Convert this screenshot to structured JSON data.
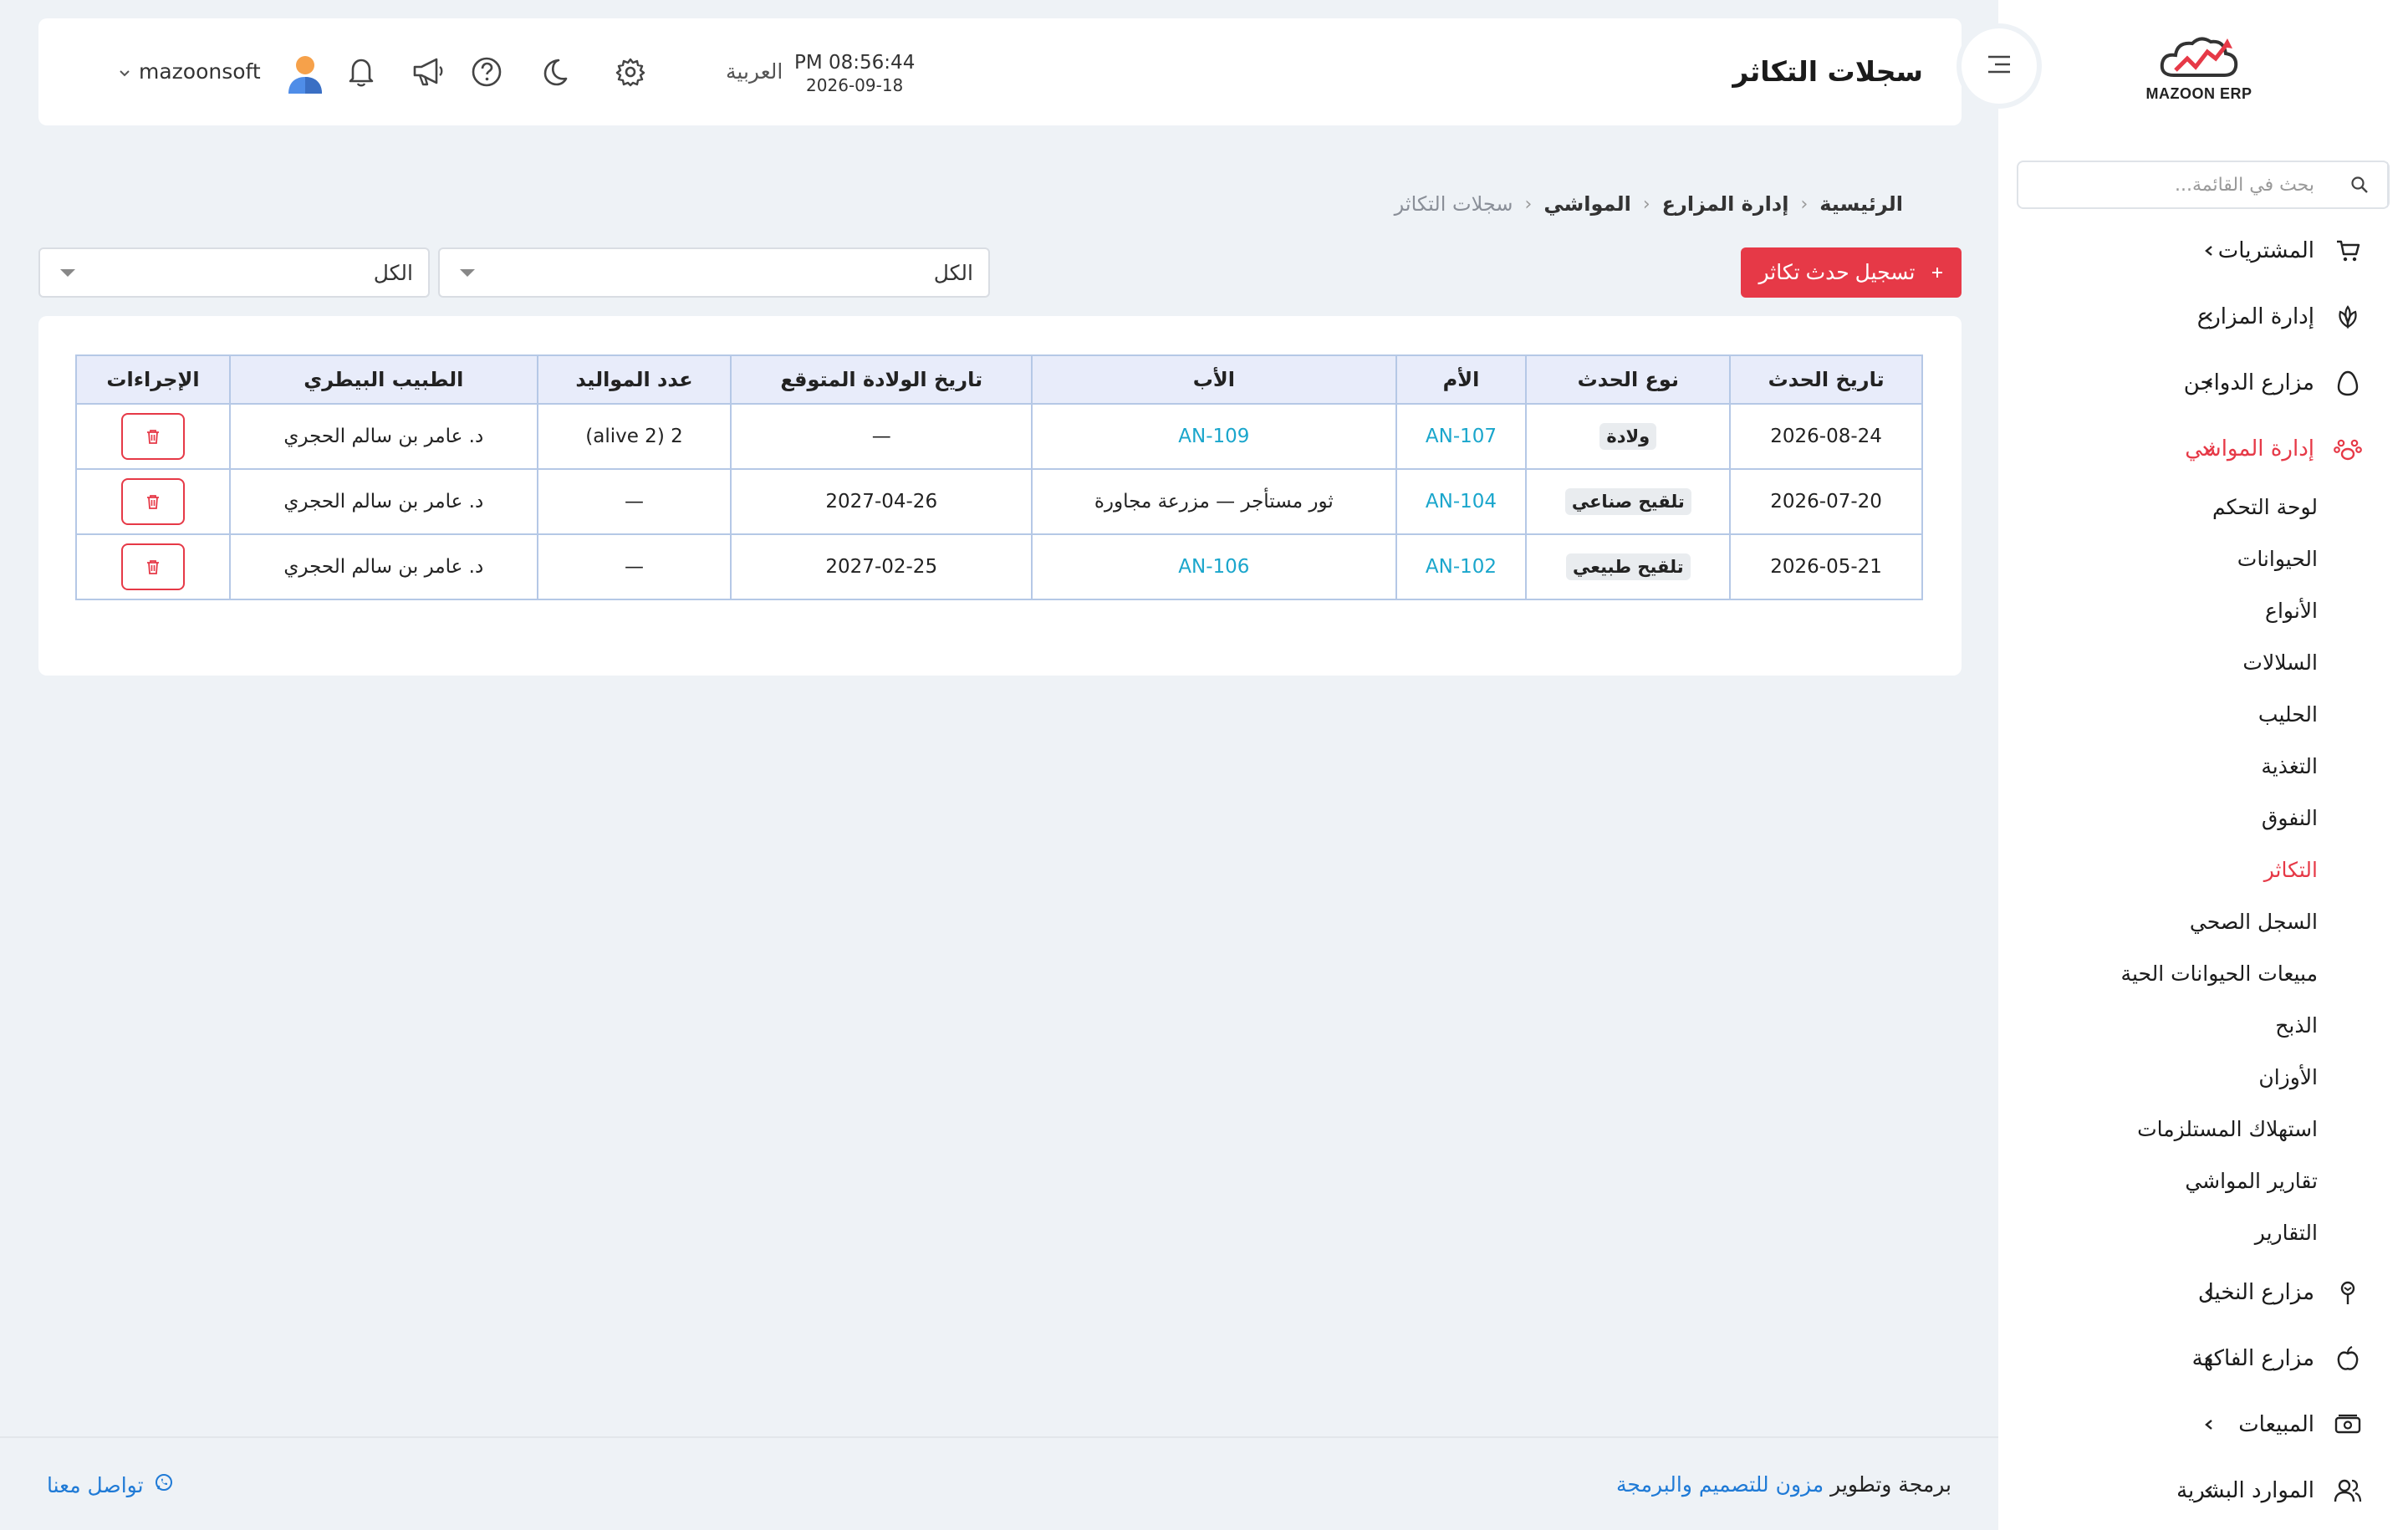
{
  "header": {
    "title": "سجلات التكاثر",
    "time": "PM 08:56:44",
    "date": "2026-09-18",
    "language": "العربية",
    "username": "mazoonsoft",
    "icons": [
      "settings-icon",
      "moon-icon",
      "help-icon",
      "megaphone-icon",
      "bell-icon"
    ]
  },
  "brand": {
    "name": "MAZOON ERP",
    "accent": "#e63947",
    "link_color": "#1aa6cc"
  },
  "sidebar": {
    "search_placeholder": "بحث في القائمة...",
    "items": [
      {
        "label": "المشتريات",
        "icon": "cart-icon"
      },
      {
        "label": "إدارة المزارع",
        "icon": "plant-icon"
      },
      {
        "label": "مزارع الدواجن",
        "icon": "egg-icon"
      },
      {
        "label": "إدارة المواشي",
        "icon": "paw-icon",
        "active": true
      },
      {
        "label": "مزارع النخيل",
        "icon": "palm-icon"
      },
      {
        "label": "مزارع الفاكهة",
        "icon": "apple-icon"
      },
      {
        "label": "المبيعات",
        "icon": "cash-icon"
      },
      {
        "label": "الموارد البشرية",
        "icon": "users-icon"
      }
    ],
    "livestock_submenu": [
      "لوحة التحكم",
      "الحيوانات",
      "الأنواع",
      "السلالات",
      "الحليب",
      "التغذية",
      "النفوق",
      "التكاثر",
      "السجل الصحي",
      "مبيعات الحيوانات الحية",
      "الذبح",
      "الأوزان",
      "استهلاك المستلزمات",
      "تقارير المواشي",
      "التقارير"
    ],
    "active_sub": "التكاثر"
  },
  "breadcrumb": [
    "الرئيسية",
    "إدارة المزارع",
    "المواشي",
    "سجلات التكاثر"
  ],
  "toolbar": {
    "add_label": "تسجيل حدث تكاثر",
    "filter1": "الكل",
    "filter2": "الكل"
  },
  "table": {
    "headers": [
      "تاريخ الحدث",
      "نوع الحدث",
      "الأم",
      "الأب",
      "تاريخ الولادة المتوقع",
      "عدد المواليد",
      "الطبيب البيطري",
      "الإجراءات"
    ],
    "rows": [
      {
        "date": "2026-08-24",
        "type": "ولادة",
        "mother": "AN-107",
        "father": "AN-109",
        "expected": "—",
        "births": "2 (alive 2)",
        "vet": "د. عامر بن سالم الحجري"
      },
      {
        "date": "2026-07-20",
        "type": "تلقيح صناعي",
        "mother": "AN-104",
        "father": "ثور مستأجر — مزرعة مجاورة",
        "expected": "2027-04-26",
        "births": "—",
        "vet": "د. عامر بن سالم الحجري"
      },
      {
        "date": "2026-05-21",
        "type": "تلقيح طبيعي",
        "mother": "AN-102",
        "father": "AN-106",
        "expected": "2027-02-25",
        "births": "—",
        "vet": "د. عامر بن سالم الحجري"
      }
    ]
  },
  "footer": {
    "prefix": "برمجة وتطوير",
    "company": "مزون للتصميم والبرمجة",
    "contact": "تواصل معنا"
  }
}
